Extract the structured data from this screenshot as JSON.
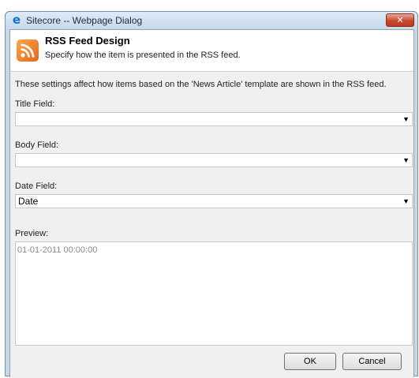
{
  "window": {
    "title": "Sitecore -- Webpage Dialog",
    "close_label": "✕"
  },
  "header": {
    "title": "RSS Feed Design",
    "subtitle": "Specify how the item is presented in the RSS feed."
  },
  "info_text": "These settings affect how items based on the 'News Article' template are shown in the RSS feed.",
  "fields": {
    "title": {
      "label": "Title Field:",
      "value": ""
    },
    "body": {
      "label": "Body Field:",
      "value": ""
    },
    "date": {
      "label": "Date Field:",
      "value": "Date"
    }
  },
  "preview": {
    "label": "Preview:",
    "text": "01-01-2011 00:00:00"
  },
  "buttons": {
    "ok": "OK",
    "cancel": "Cancel"
  },
  "icons": {
    "window": "ie-icon",
    "header": "rss-icon",
    "dropdown": "chevron-down-icon"
  },
  "colors": {
    "rss_orange": "#f08a2c",
    "titlebar": "#c6d9ed",
    "close": "#c9492c"
  }
}
